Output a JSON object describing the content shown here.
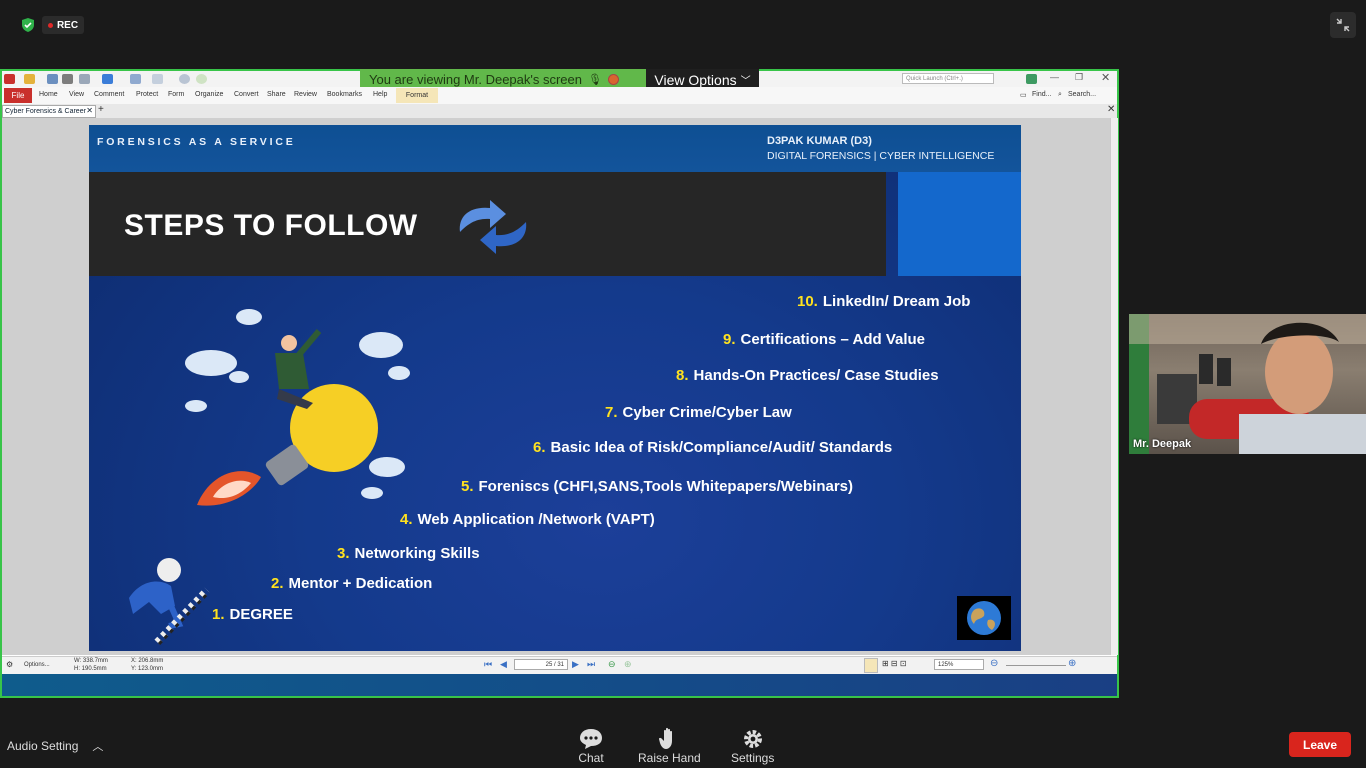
{
  "meeting": {
    "rec_label": "REC",
    "viewing_banner": "You are viewing Mr. Deepak's screen",
    "view_options_label": "View Options",
    "participant_name": "Mr. Deepak"
  },
  "pdf_app": {
    "menu": [
      "File",
      "Home",
      "View",
      "Comment",
      "Protect",
      "Form",
      "Organize",
      "Convert",
      "Share",
      "Review",
      "Bookmarks",
      "Help",
      "Format"
    ],
    "quick_launch_placeholder": "Quick Launch (Ctrl+.)",
    "find_label": "Find...",
    "search_label": "Search...",
    "doc_tab": "Cyber Forensics & Career",
    "status": {
      "options_label": "Options...",
      "w": "W: 338.7mm",
      "h": "H: 190.5mm",
      "x": "X: 206.8mm",
      "y": "Y: 123.0mm",
      "page": "25 / 31",
      "zoom": "125%"
    }
  },
  "slide": {
    "header_left": "FORENSICS AS A SERVICE",
    "author_line1": "D3PAK KUMAR (D3)",
    "author_line2": "DIGITAL FORENSICS | CYBER INTELLIGENCE",
    "title": "STEPS TO FOLLOW",
    "steps": [
      {
        "num": "10.",
        "text": "LinkedIn/ Dream Job"
      },
      {
        "num": "9.",
        "text": "Certifications – Add Value"
      },
      {
        "num": "8.",
        "text": "Hands-On Practices/ Case Studies"
      },
      {
        "num": "7.",
        "text": "Cyber Crime/Cyber Law"
      },
      {
        "num": "6.",
        "text": "Basic Idea of Risk/Compliance/Audit/ Standards"
      },
      {
        "num": "5.",
        "text": "Foreniscs (CHFI,SANS,Tools Whitepapers/Webinars)"
      },
      {
        "num": "4.",
        "text": "Web Application /Network (VAPT)"
      },
      {
        "num": "3.",
        "text": "Networking Skills"
      },
      {
        "num": "2.",
        "text": "Mentor + Dedication"
      },
      {
        "num": "1.",
        "text": "DEGREE"
      }
    ]
  },
  "footer": {
    "audio_setting": "Audio Setting",
    "chat": "Chat",
    "raise_hand": "Raise Hand",
    "settings": "Settings",
    "leave": "Leave"
  },
  "colors": {
    "accent_green": "#38c449",
    "leave_red": "#d9251d",
    "step_number_yellow": "#ffe21f"
  }
}
